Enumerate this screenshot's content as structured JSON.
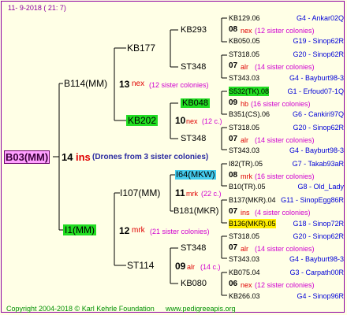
{
  "header": {
    "date": "11-  9-2018 (  21:  7)"
  },
  "footer": {
    "copyright": "Copyright 2004-2018 © Karl Kehrle Foundation",
    "website": "www.pedigreeapis.org"
  },
  "root": {
    "name": "B03(MM)",
    "count": "14",
    "tag": "ins",
    "note": "(Drones from 3 sister colonies)"
  },
  "gen1": [
    {
      "name": "B114(MM)",
      "count": "13",
      "tag": "nex",
      "note": "(12 sister colonies)"
    },
    {
      "name": "I1(MM)",
      "count": "12",
      "tag": "mrk",
      "note": "(21 sister colonies)"
    }
  ],
  "gen2": [
    {
      "name": "KB177"
    },
    {
      "name": "KB202",
      "count": "10",
      "tag": "nex",
      "note": "(12 c.)"
    },
    {
      "name": "I107(MM)",
      "count": "11",
      "tag": "mrk",
      "note": "(22 c.)"
    },
    {
      "name": "ST114",
      "count": "09",
      "tag": "alr",
      "note": "(14 c.)"
    }
  ],
  "gen3": [
    {
      "name": "KB293",
      "count": "10",
      "tag": "nex",
      "note": "(12 c.)"
    },
    {
      "name": "ST348"
    },
    {
      "name": "KB048"
    },
    {
      "name": "ST348"
    },
    {
      "name": "I64(MKW)"
    },
    {
      "name": "B181(MKR)"
    },
    {
      "name": "ST348"
    },
    {
      "name": "KB080"
    }
  ],
  "gen4": [
    {
      "name": "KB129.06",
      "info": "G4 - Ankar02Q"
    },
    {
      "count": "08",
      "tag": "nex",
      "note": "(12 sister colonies)"
    },
    {
      "name": "KB050.05",
      "info": "G19 - Sinop62R"
    },
    {
      "name": "ST318.05",
      "info": "G20 - Sinop62R"
    },
    {
      "count": "07",
      "tag": "alr",
      "note": "(14 sister colonies)"
    },
    {
      "name": "ST343.03",
      "info": "G4 - Bayburt98-3"
    },
    {
      "name": "S532(TK).08",
      "info": "G1 - Erfoud07-1Q"
    },
    {
      "count": "09",
      "tag": "hb",
      "note": "(16 sister colonies)"
    },
    {
      "name": "B351(CS).06",
      "info": "G6 - Cankiri97Q"
    },
    {
      "name": "ST318.05",
      "info": "G20 - Sinop62R"
    },
    {
      "count": "07",
      "tag": "alr",
      "note": "(14 sister colonies)"
    },
    {
      "name": "ST343.03",
      "info": "G4 - Bayburt98-3"
    },
    {
      "name": "I82(TR).05",
      "info": "G7 - Takab93aR"
    },
    {
      "count": "08",
      "tag": "mrk",
      "note": "(16 sister colonies)"
    },
    {
      "name": "B10(TR).05",
      "info": "G8 - Old_Lady"
    },
    {
      "name": "B137(MKR).04",
      "info": "G11 - SinopEgg86R"
    },
    {
      "count": "07",
      "tag": "ins",
      "note": "(4 sister colonies)"
    },
    {
      "name": "B136(MKR).05",
      "info": "G18 - Sinop72R"
    },
    {
      "name": "ST318.05",
      "info": "G20 - Sinop62R"
    },
    {
      "count": "07",
      "tag": "alr",
      "note": "(14 sister colonies)"
    },
    {
      "name": "ST343.03",
      "info": "G4 - Bayburt98-3"
    },
    {
      "name": "KB075.04",
      "info": "G3 - Carpath00R"
    },
    {
      "count": "06",
      "tag": "nex",
      "note": "(12 sister colonies)"
    },
    {
      "name": "KB266.03",
      "info": "G4 - Sinop96R"
    }
  ],
  "colors": {
    "border": "#8c00a0",
    "line": "#000000",
    "name_blue": "#0000d8",
    "tag_red": "#e00000",
    "note_purple": "#d000d0",
    "hl_green": "#22dd22",
    "hl_yellow": "#ffee00",
    "hl_cyan": "#44ccee",
    "hl_pink": "#ffa0ff"
  }
}
